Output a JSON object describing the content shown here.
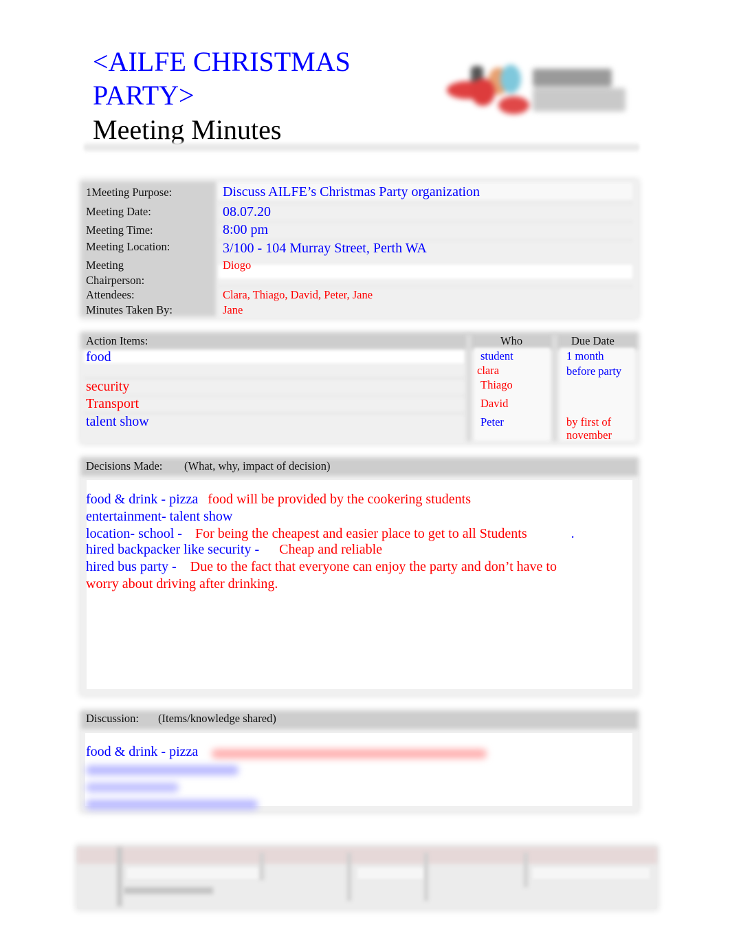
{
  "header": {
    "title_line1": "<AILFE CHRISTMAS",
    "title_line2": "PARTY>",
    "subtitle": "Meeting Minutes",
    "logo": "ailfe-logo"
  },
  "meeting_info": {
    "rows": [
      {
        "label": "1Meeting Purpose:",
        "value": "Discuss AILFE’s Christmas Party organization"
      },
      {
        "label": "Meeting Date:",
        "value": "08.07.20"
      },
      {
        "label": "Meeting Time:",
        "value": "8:00 pm"
      },
      {
        "label": "Meeting Location:",
        "value": "3/100 - 104 Murray Street, Perth WA"
      },
      {
        "label": "Meeting",
        "label2": "Chairperson:",
        "value": "Diogo"
      },
      {
        "label": "Attendees:",
        "value": "Clara, Thiago, David, Peter, Jane"
      },
      {
        "label": "Minutes Taken By:",
        "value": "Jane"
      }
    ]
  },
  "action_items": {
    "header": "Action Items:",
    "who_header": "Who",
    "due_header": "Due Date",
    "rows": [
      {
        "item": "food",
        "who": "student",
        "who2": "clara",
        "due": "1 month",
        "due2": "before party"
      },
      {
        "item": "security",
        "who": "Thiago",
        "due": ""
      },
      {
        "item": "Transport",
        "who": "David",
        "due": ""
      },
      {
        "item": "talent show",
        "who": "Peter",
        "due": "by first of",
        "due2": "november"
      }
    ]
  },
  "decisions": {
    "header": "Decisions Made:",
    "subheader": "(What, why, impact of decision)",
    "lines": [
      {
        "what": "food & drink - pizza",
        "why": "food will be provided by the cookering students"
      },
      {
        "what": "entertainment- talent show",
        "why": ""
      },
      {
        "what": "location- school -",
        "why": "For being the cheapest and easier place to get to all Students",
        "trailing": "."
      },
      {
        "what": "hired backpacker like security -",
        "why": "Cheap and reliable"
      },
      {
        "what": "hired bus party -",
        "why": "Due to the fact that everyone can enjoy the party and don’t have to"
      },
      {
        "what": "",
        "why": "worry about driving after drinking."
      }
    ]
  },
  "discussion": {
    "header": "Discussion:",
    "subheader": "(Items/knowledge shared)",
    "first_line": "food & drink - pizza",
    "blurred_note": "content obscured (blurred)"
  },
  "footer_table": {
    "note": "blurred table (unreadable)"
  }
}
